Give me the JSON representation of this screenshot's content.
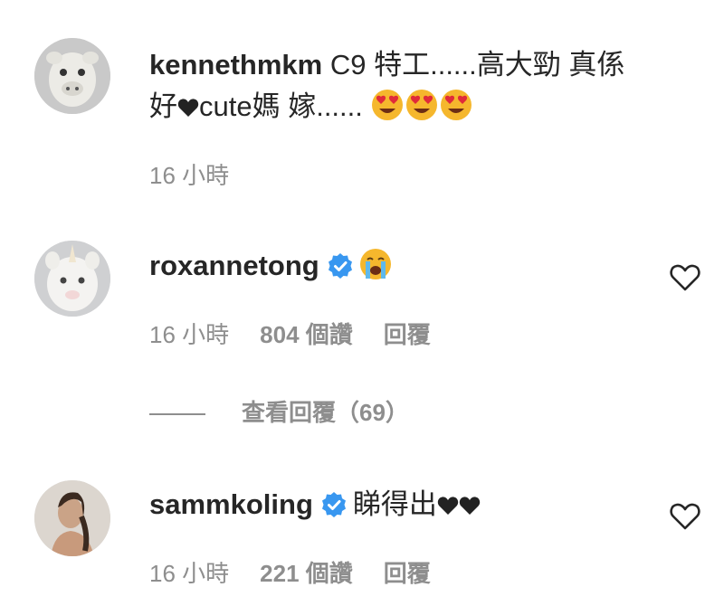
{
  "comments": [
    {
      "username": "kennethmkm",
      "text_line1": " C9 特工......高大勁 真係",
      "text_line2_a": "好",
      "text_line2_b": "cute媽 嫁......",
      "timestamp": "16 小時",
      "avatar_icon": "plush-toy-avatar",
      "emojis": [
        "heart-eyes-emoji",
        "heart-eyes-emoji",
        "heart-eyes-emoji"
      ]
    },
    {
      "username": "roxannetong",
      "verified": true,
      "text": "",
      "emoji": "crying-face-emoji",
      "timestamp": "16 小時",
      "likes": "804 個讚",
      "reply": "回覆",
      "avatar_icon": "white-unicorn-avatar"
    },
    {
      "username": "sammkoling",
      "verified": true,
      "text": "睇得出",
      "timestamp": "16 小時",
      "likes": "221 個讚",
      "reply": "回覆",
      "avatar_icon": "woman-portrait-avatar"
    }
  ],
  "view_replies": "查看回覆（69）",
  "colors": {
    "text": "#262626",
    "meta": "#8e8e8e",
    "verified": "#3897f0"
  }
}
